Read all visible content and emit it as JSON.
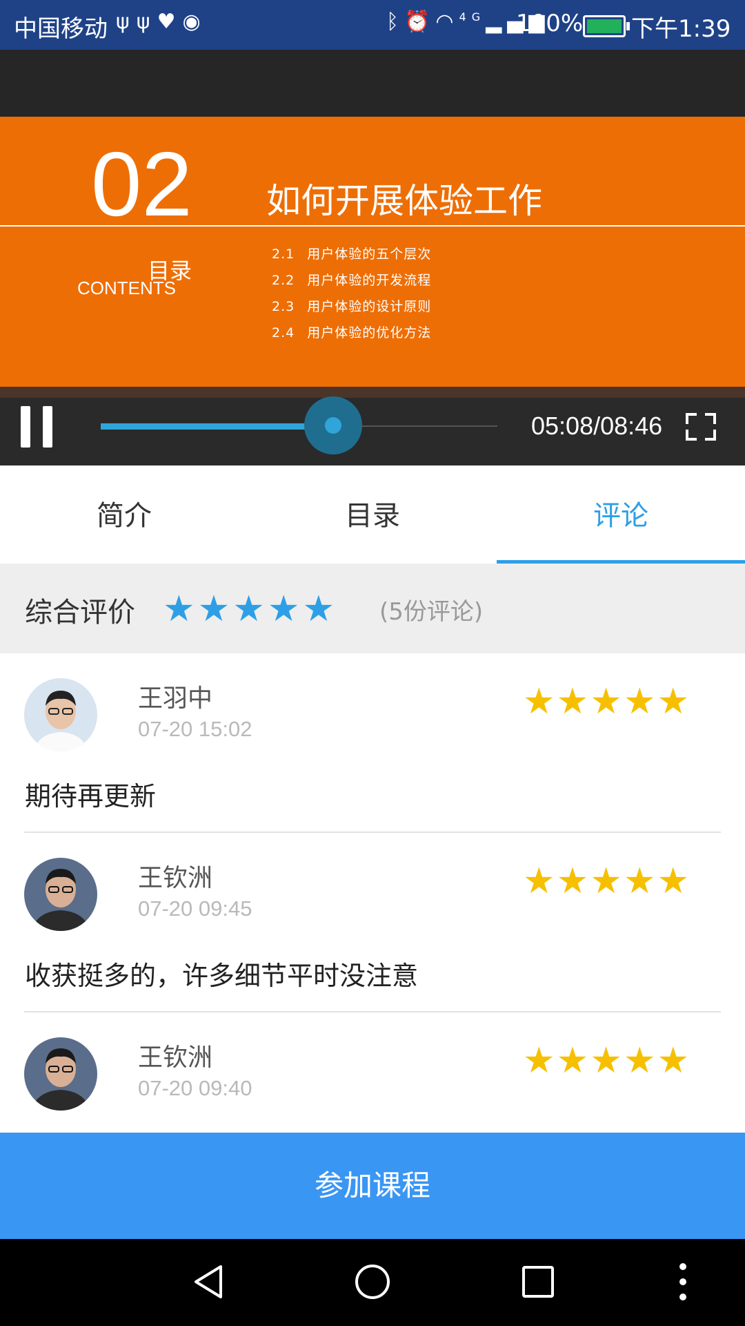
{
  "status_bar": {
    "carrier": "中国移动",
    "left_icons": [
      "usb-icon",
      "usb-icon",
      "health-icon",
      "app-icon"
    ],
    "right_icons": [
      "bluetooth-icon",
      "alarm-icon",
      "wifi-icon",
      "signal-4g-icon"
    ],
    "network": "4G",
    "battery_percent": "100%",
    "time": "下午1:39"
  },
  "video": {
    "slide": {
      "chapter_number": "02",
      "chapter_title": "如何开展体验工作",
      "toc_label_cn": "目录",
      "toc_label_en": "CONTENTS",
      "items": [
        {
          "num": "2.1",
          "text": "用户体验的五个层次"
        },
        {
          "num": "2.2",
          "text": "用户体验的开发流程"
        },
        {
          "num": "2.3",
          "text": "用户体验的设计原则"
        },
        {
          "num": "2.4",
          "text": "用户体验的优化方法"
        }
      ]
    },
    "player": {
      "state": "playing",
      "progress_fraction": 0.586,
      "time_label": "05:08/08:46",
      "colors": {
        "accent": "#2fa5da"
      }
    }
  },
  "tabs": {
    "items": [
      {
        "label": "简介"
      },
      {
        "label": "目录"
      },
      {
        "label": "评论"
      }
    ],
    "active_index": 2,
    "active_color": "#2e9fe6"
  },
  "overall_rating": {
    "label": "综合评价",
    "stars": 5,
    "count_label": "(5份评论)",
    "star_color": "#2e9fe6"
  },
  "reviews": [
    {
      "name": "王羽中",
      "date": "07-20 15:02",
      "stars": 5,
      "comment": "期待再更新"
    },
    {
      "name": "王钦洲",
      "date": "07-20 09:45",
      "stars": 5,
      "comment": "收获挺多的，许多细节平时没注意"
    },
    {
      "name": "王钦洲",
      "date": "07-20 09:40",
      "stars": 5,
      "comment": ""
    }
  ],
  "review_star_color": "#f6c000",
  "join_button": {
    "label": "参加课程",
    "color": "#3a96f3"
  },
  "nav_bar": {
    "icons": [
      "back-icon",
      "home-icon",
      "recents-icon",
      "more-icon"
    ]
  }
}
